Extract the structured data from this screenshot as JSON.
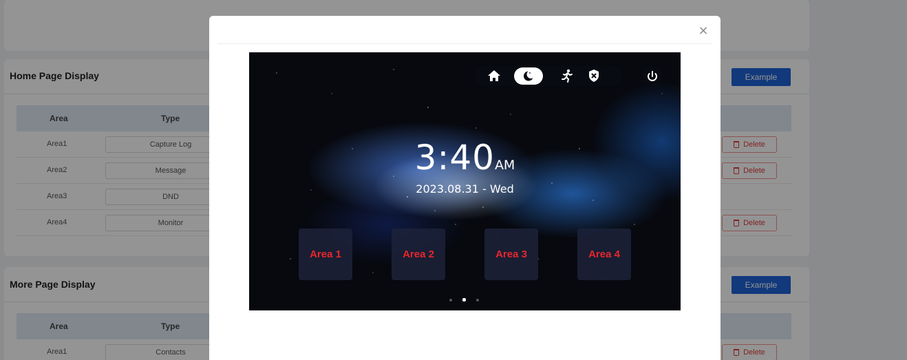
{
  "home_section": {
    "title": "Home Page Display",
    "example_label": "Example",
    "columns": {
      "area": "Area",
      "type": "Type"
    },
    "rows": [
      {
        "area": "Area1",
        "type": "Capture Log",
        "delete": "Delete"
      },
      {
        "area": "Area2",
        "type": "Message",
        "delete": "Delete"
      },
      {
        "area": "Area3",
        "type": "DND",
        "delete": ""
      },
      {
        "area": "Area4",
        "type": "Monitor",
        "delete": "Delete"
      }
    ]
  },
  "more_section": {
    "title": "More Page Display",
    "example_label": "Example",
    "columns": {
      "area": "Area",
      "type": "Type"
    },
    "rows": [
      {
        "area": "Area1",
        "type": "Contacts",
        "delete": "Delete"
      }
    ]
  },
  "modal": {
    "close_glyph": "×",
    "device": {
      "time": "3:40",
      "ampm": "AM",
      "date": "2023.08.31 - Wed",
      "status_icons": [
        "home-icon",
        "moon-icon",
        "running-person-icon",
        "shield-x-icon"
      ],
      "active_status": "moon-icon",
      "power_icon": "power-icon",
      "tiles": [
        "Area 1",
        "Area 2",
        "Area 3",
        "Area 4"
      ],
      "page_dots": {
        "count": 3,
        "active": 2
      }
    }
  },
  "colors": {
    "primary": "#1e63d6",
    "danger": "#e03b3b",
    "tile_text": "#e8262c",
    "header_row": "#dfe8f3"
  }
}
